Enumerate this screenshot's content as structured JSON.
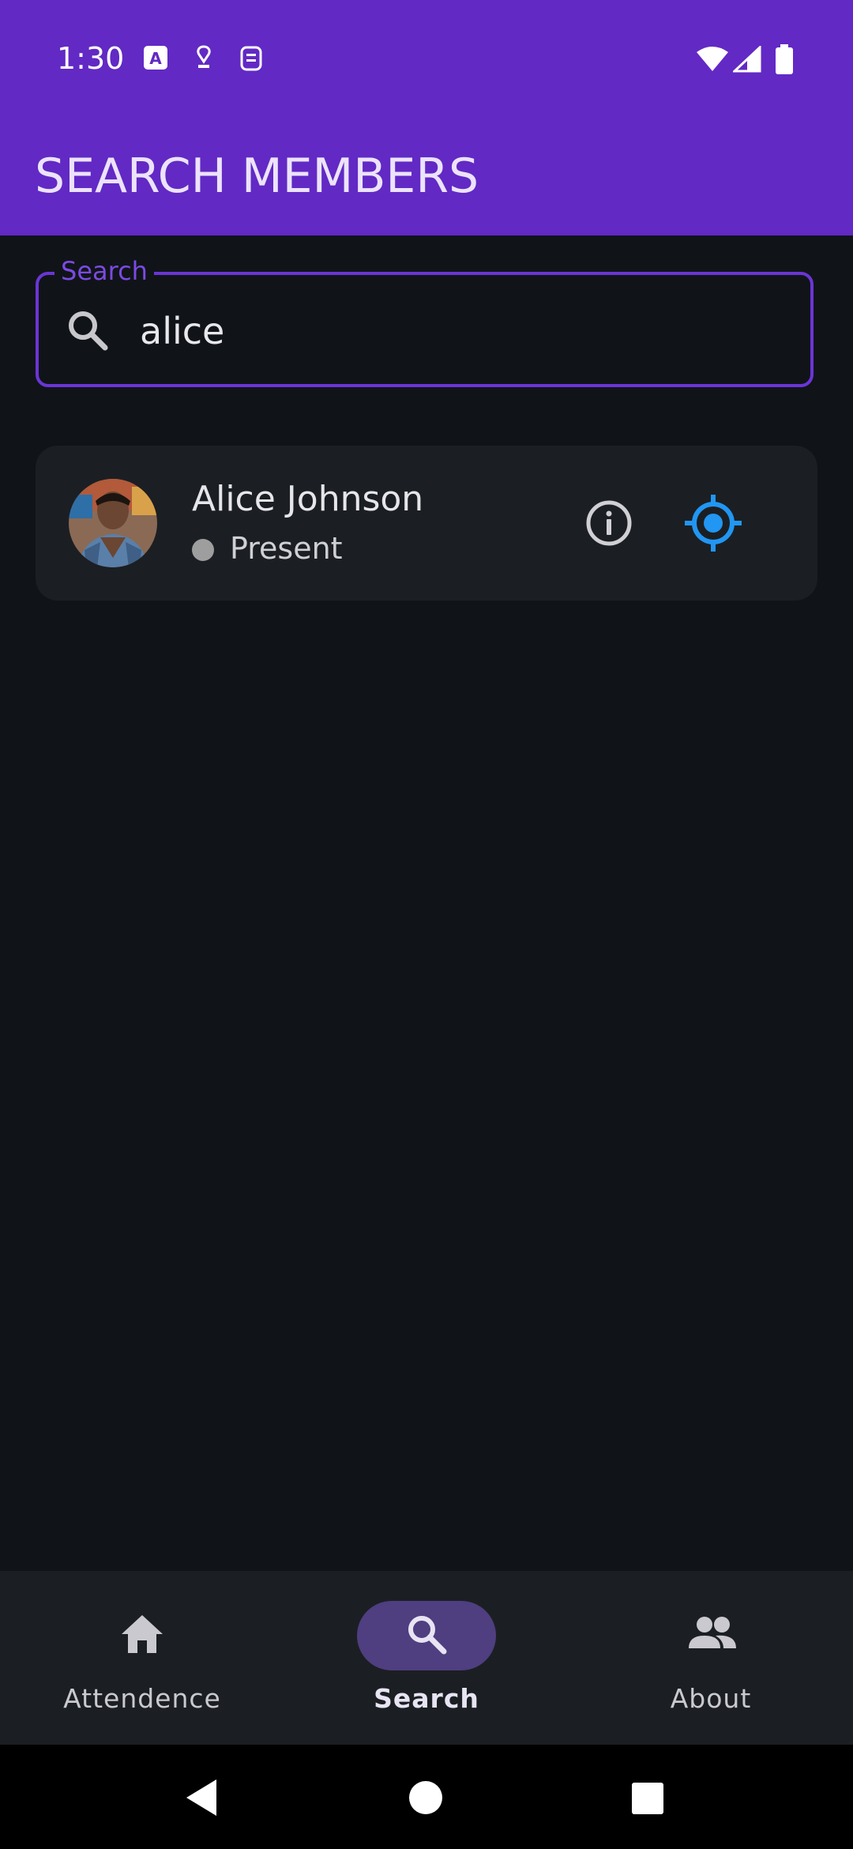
{
  "status_bar": {
    "time": "1:30",
    "icons": [
      "text-a-icon",
      "location-pin-icon",
      "sim-toolkit-icon",
      "wifi-icon",
      "signal-icon",
      "battery-icon"
    ]
  },
  "app_bar": {
    "title": "SEARCH MEMBERS"
  },
  "search": {
    "label": "Search",
    "value": "alice",
    "icon": "search-icon"
  },
  "results": [
    {
      "name": "Alice Johnson",
      "status": "Present",
      "status_color": "#9e9e9e",
      "actions": [
        "info-icon",
        "gps-fixed-icon"
      ]
    }
  ],
  "bottom_nav": {
    "items": [
      {
        "label": "Attendence",
        "icon": "home-icon",
        "active": false
      },
      {
        "label": "Search",
        "icon": "search-icon",
        "active": true
      },
      {
        "label": "About",
        "icon": "group-icon",
        "active": false
      }
    ]
  },
  "colors": {
    "primary": "#6229c4",
    "background": "#101418",
    "card": "#1b1f23",
    "accent_blue": "#2196f3",
    "nav_active_pill": "#4f3e80"
  }
}
